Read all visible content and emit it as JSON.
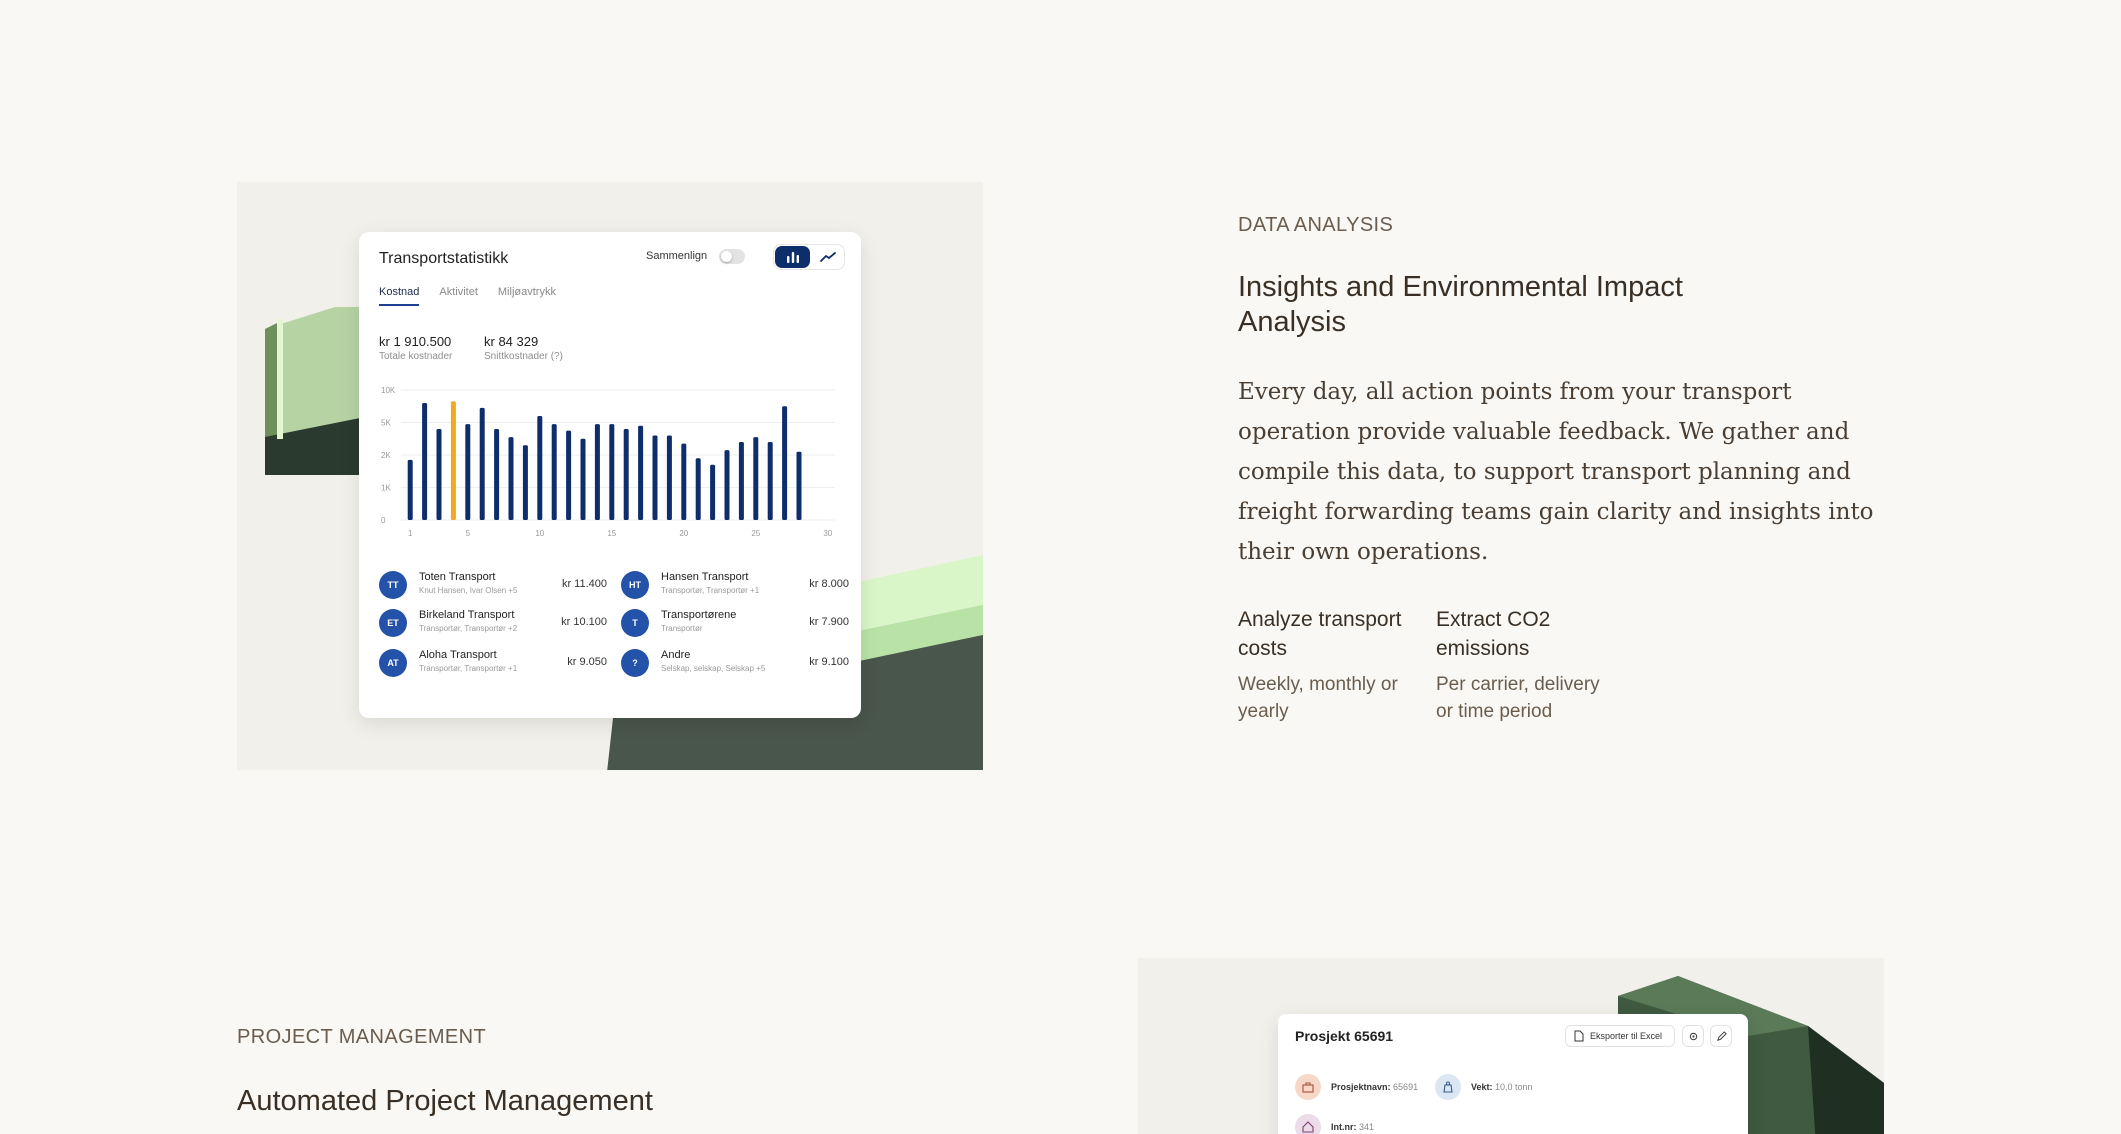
{
  "section1": {
    "eyebrow": "DATA ANALYSIS",
    "title": "Insights and Environmental Impact Analysis",
    "body": "Every day, all action points from your transport operation provide valuable feedback. We gather and compile this data, to support transport planning and freight forwarding teams gain clarity and insights into their own operations.",
    "features": [
      {
        "title": "Analyze transport costs",
        "desc": "Weekly, monthly or yearly"
      },
      {
        "title": "Extract CO2 emissions",
        "desc": "Per carrier, delivery or time period"
      }
    ]
  },
  "card": {
    "title": "Transportstatistikk",
    "compare_label": "Sammenlign",
    "tabs": [
      "Kostnad",
      "Aktivitet",
      "Miljøavtrykk"
    ],
    "kpis": [
      {
        "value": "kr 1 910.500",
        "label": "Totale kostnader"
      },
      {
        "value": "kr 84 329",
        "label": "Snittkostnader (?)"
      }
    ],
    "carriers": [
      {
        "initials": "TT",
        "name": "Toten Transport",
        "sub": "Knut Hansen, Ivar Olsen +5",
        "amount": "kr 11.400"
      },
      {
        "initials": "HT",
        "name": "Hansen Transport",
        "sub": "Transportør, Transportør +1",
        "amount": "kr 8.000"
      },
      {
        "initials": "ET",
        "name": "Birkeland Transport",
        "sub": "Transportør, Transportør +2",
        "amount": "kr 10.100"
      },
      {
        "initials": "T",
        "name": "Transportørene",
        "sub": "Transportør",
        "amount": "kr 7.900"
      },
      {
        "initials": "AT",
        "name": "Aloha Transport",
        "sub": "Transportør, Transportør +1",
        "amount": "kr 9.050"
      },
      {
        "initials": "?",
        "name": "Andre",
        "sub": "Selskap, selskap, Selskap +5",
        "amount": "kr 9.100"
      }
    ]
  },
  "chart_data": {
    "type": "bar",
    "title": "",
    "x": [
      1,
      2,
      3,
      4,
      5,
      6,
      7,
      8,
      9,
      10,
      11,
      12,
      13,
      14,
      15,
      16,
      17,
      18,
      19,
      20,
      21,
      22,
      23,
      24,
      25,
      26,
      27,
      28,
      29,
      30
    ],
    "values": [
      3.7,
      7.2,
      5.6,
      7.3,
      5.9,
      6.9,
      5.6,
      5.1,
      4.6,
      6.4,
      5.9,
      5.5,
      5.0,
      5.9,
      5.9,
      5.6,
      5.8,
      5.2,
      5.2,
      4.7,
      3.8,
      3.4,
      4.3,
      4.8,
      5.1,
      4.8,
      7.0,
      4.2,
      0,
      0
    ],
    "highlight_index": 3,
    "bar_color": "#0e2d6b",
    "highlight_color": "#f5a623",
    "yticks": [
      "0",
      "1K",
      "2K",
      "5K",
      "10K"
    ],
    "xticks": [
      "1",
      "5",
      "10",
      "15",
      "20",
      "25",
      "30"
    ],
    "ylim": [
      0,
      8
    ]
  },
  "section2": {
    "eyebrow": "PROJECT MANAGEMENT",
    "title": "Automated Project Management"
  },
  "project_card": {
    "title": "Prosjekt 65691",
    "export_label": "Eksporter til Excel",
    "fields": [
      {
        "key": "Prosjektnavn:",
        "value": "65691",
        "color": "#f6d7c8"
      },
      {
        "key": "Vekt:",
        "value": "10,0 tonn",
        "color": "#dbe6f3"
      },
      {
        "key": "Int.nr:",
        "value": "341",
        "color": "#ecdbe8"
      }
    ]
  }
}
